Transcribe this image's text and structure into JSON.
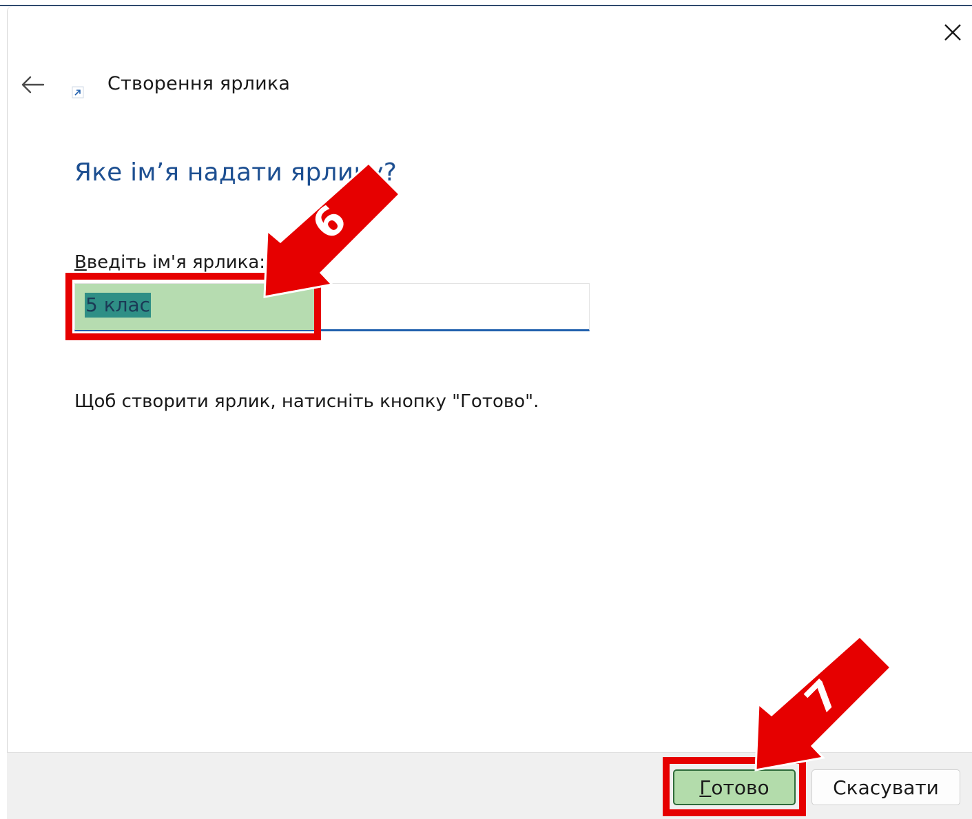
{
  "window": {
    "close_icon": "close-icon",
    "back_icon": "arrow-left-icon",
    "shortcut_icon": "shortcut-arrow-icon",
    "title": "Створення ярлика"
  },
  "content": {
    "question": "Яке ім’я надати ярлику?",
    "field_label_accesskey": "В",
    "field_label_rest": "ведіть ім'я ярлика:",
    "input_value": "5 клас",
    "hint": "Щоб створити ярлик, натисніть кнопку \"Готово\"."
  },
  "footer": {
    "finish_accesskey": "Г",
    "finish_rest": "отово",
    "cancel_label": "Скасувати"
  },
  "annotations": {
    "step_6": "6",
    "step_7": "7",
    "accent": "#e60000"
  },
  "colors": {
    "question_text": "#1d4f91",
    "input_underline": "#1f5fad",
    "selection_fill": "#b6dcb0",
    "highlight": "#e60000"
  }
}
